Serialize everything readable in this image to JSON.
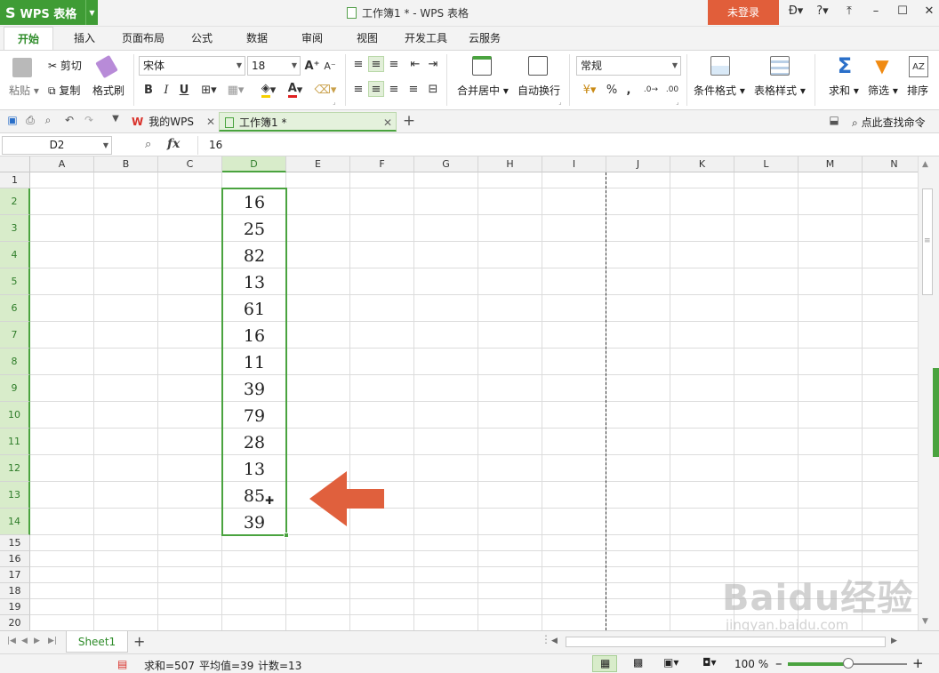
{
  "app": {
    "name": "WPS 表格",
    "window_title": "工作簿1 * - WPS 表格",
    "login_label": "未登录",
    "title_icons": [
      "skin-icon",
      "help-icon",
      "restore-ribbon-icon",
      "minimize-icon",
      "maximize-icon",
      "close-icon"
    ],
    "brand_color": "#3f9c35",
    "accent_color": "#e15e3a"
  },
  "ribbon_tabs": [
    "开始",
    "插入",
    "页面布局",
    "公式",
    "数据",
    "审阅",
    "视图",
    "开发工具",
    "云服务"
  ],
  "ribbon": {
    "paste": "粘贴",
    "cut": "剪切",
    "copy": "复制",
    "format_painter": "格式刷",
    "font_name": "宋体",
    "font_size": "18",
    "merge_center": "合并居中",
    "wrap_text": "自动换行",
    "number_format": "常规",
    "conditional_format": "条件格式",
    "table_style": "表格样式",
    "sum": "求和",
    "filter": "筛选",
    "sort": "排序"
  },
  "quickbar": {
    "tabs": [
      {
        "label": "我的WPS",
        "active": false
      },
      {
        "label": "工作簿1 *",
        "active": true
      }
    ],
    "find_command": "点此查找命令"
  },
  "formula_bar": {
    "name_box": "D2",
    "fx": "fx",
    "value": "16"
  },
  "grid": {
    "columns": [
      "A",
      "B",
      "C",
      "D",
      "E",
      "F",
      "G",
      "H",
      "I",
      "J",
      "K",
      "L",
      "M",
      "N"
    ],
    "selected_column": "D",
    "rows": [
      "1",
      "2",
      "3",
      "4",
      "5",
      "6",
      "7",
      "8",
      "9",
      "10",
      "11",
      "12",
      "13",
      "14",
      "15",
      "16",
      "17",
      "18",
      "19",
      "20"
    ],
    "column_d_values": [
      "16",
      "25",
      "82",
      "13",
      "61",
      "16",
      "11",
      "39",
      "79",
      "28",
      "13",
      "85",
      "39"
    ],
    "arrow_color": "#e0603d"
  },
  "sheets": [
    "Sheet1"
  ],
  "status": {
    "sum": "求和=507",
    "average": "平均值=39",
    "count": "计数=13",
    "zoom": "100 %"
  },
  "watermark": {
    "brand": "Baidu经验",
    "url": "jingyan.baidu.com"
  }
}
